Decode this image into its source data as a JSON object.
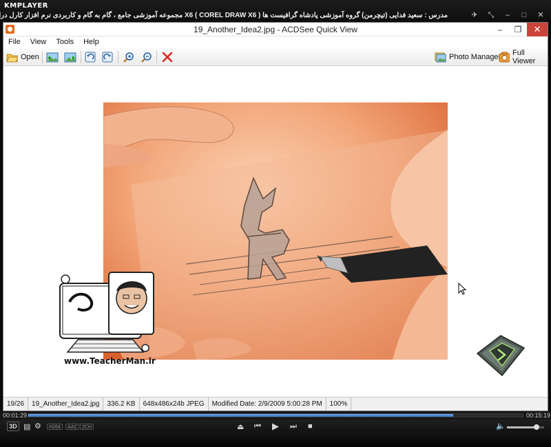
{
  "player": {
    "logo": "KMPLAYER",
    "caption": "مجموعه آموزشی جامع ، گام به گام و کاربردی نرم افزار کارل دراو X6 ( COREL DRAW X6 )   مدرس : سعید فدایی (تیچرمن) گروه آموزشی پادشاه گرافیست ها",
    "time_elapsed": "00:01:29",
    "time_remaining": "00:15:19",
    "progress_fraction": 0.86,
    "volume_fraction": 0.8,
    "btn_3d": "3D",
    "badges": [
      "H264",
      "AAC",
      "2CH"
    ]
  },
  "viewer": {
    "title": "19_Another_Idea2.jpg - ACDSee Quick View",
    "menu": [
      "File",
      "View",
      "Tools",
      "Help"
    ],
    "toolbar": {
      "open": "Open",
      "photo_manager": "Photo Manager",
      "full_viewer": "Full Viewer"
    },
    "status": {
      "index": "19/26",
      "filename": "19_Another_Idea2.jpg",
      "size": "336.2 KB",
      "dimensions": "648x486x24b JPEG",
      "modified": "Modified Date: 2/9/2009 5:00:28 PM",
      "zoom": "100%"
    }
  },
  "overlay": {
    "teacher_url": "www.TeacherMan.ir",
    "teacher_label": "Teacher Man"
  },
  "colors": {
    "accent": "#3b74c2",
    "close_red": "#c9453b",
    "photo_orange": "#e8905a"
  }
}
